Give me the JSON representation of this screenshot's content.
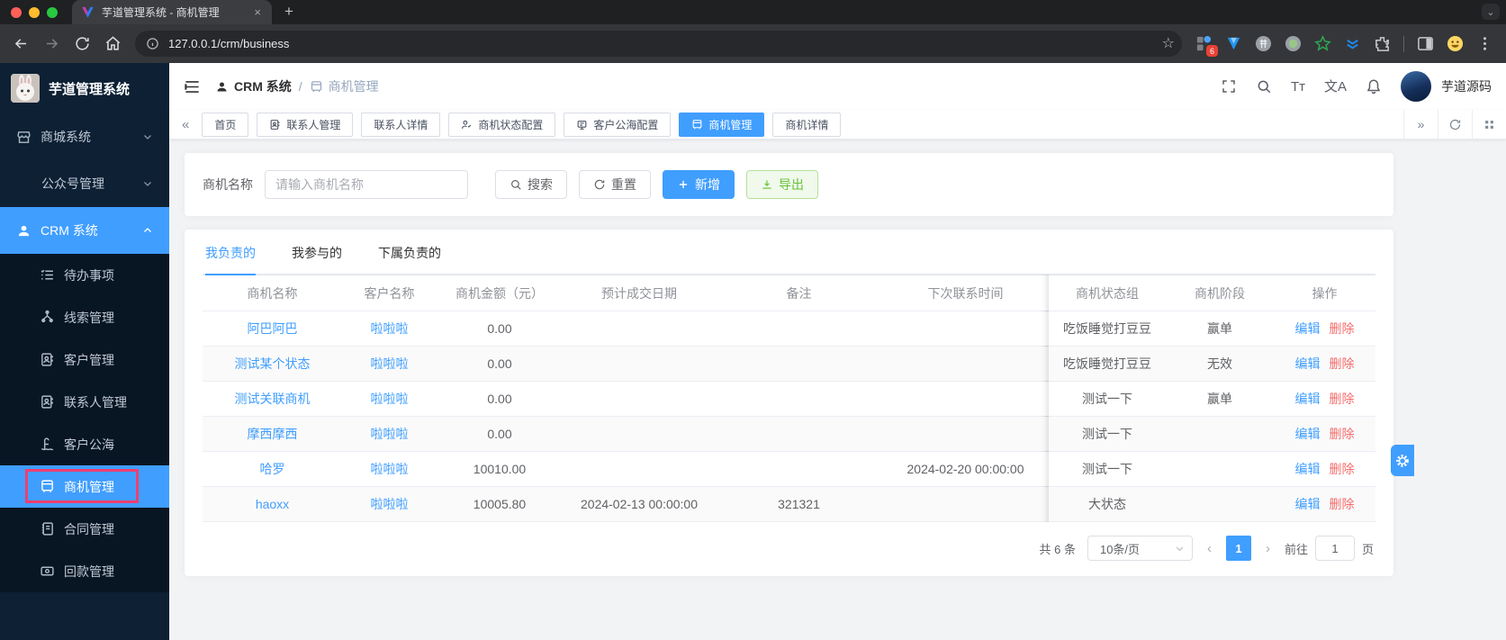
{
  "browser": {
    "tab_title": "芋道管理系统 - 商机管理",
    "url": "127.0.0.1/crm/business",
    "extension_badge": "6"
  },
  "icons_text": {
    "tab_close": "×",
    "new_tab": "+",
    "tab_search_chevron": "⌄",
    "bookmark_star": "☆",
    "font_size": "Tт",
    "language": "文A",
    "tags_collapse_left": "«",
    "tags_collapse_right": "»",
    "pager_prev": "‹",
    "pager_next": "›",
    "plus": "＋"
  },
  "sidebar": {
    "logo_title": "芋道管理系统",
    "top_menu": [
      {
        "label": "商城系统"
      },
      {
        "label": "公众号管理"
      },
      {
        "label": "CRM 系统"
      }
    ],
    "sub_menu": [
      {
        "label": "待办事项"
      },
      {
        "label": "线索管理"
      },
      {
        "label": "客户管理"
      },
      {
        "label": "联系人管理"
      },
      {
        "label": "客户公海"
      },
      {
        "label": "商机管理"
      },
      {
        "label": "合同管理"
      },
      {
        "label": "回款管理"
      }
    ]
  },
  "header": {
    "breadcrumb_1": "CRM 系统",
    "separator": "/",
    "breadcrumb_2": "商机管理",
    "username": "芋道源码"
  },
  "tags": {
    "items": [
      {
        "label": "首页"
      },
      {
        "label": "联系人管理"
      },
      {
        "label": "联系人详情"
      },
      {
        "label": "商机状态配置"
      },
      {
        "label": "客户公海配置"
      },
      {
        "label": "商机管理"
      },
      {
        "label": "商机详情"
      }
    ]
  },
  "search": {
    "label": "商机名称",
    "placeholder": "请输入商机名称",
    "search_btn": "搜索",
    "reset_btn": "重置",
    "add_btn": "新增",
    "export_btn": "导出"
  },
  "tabs": {
    "mine": "我负责的",
    "joined": "我参与的",
    "subordinate": "下属负责的"
  },
  "table": {
    "headers": [
      "商机名称",
      "客户名称",
      "商机金额（元）",
      "预计成交日期",
      "备注",
      "下次联系时间",
      "商机状态组",
      "商机阶段",
      "操作"
    ],
    "edit_label": "编辑",
    "delete_label": "删除",
    "rows": [
      {
        "name": "阿巴阿巴",
        "customer": "啦啦啦",
        "amount": "0.00",
        "expected": "",
        "remark": "",
        "next_time": "",
        "status_group": "吃饭睡觉打豆豆",
        "stage": "赢单"
      },
      {
        "name": "测试某个状态",
        "customer": "啦啦啦",
        "amount": "0.00",
        "expected": "",
        "remark": "",
        "next_time": "",
        "status_group": "吃饭睡觉打豆豆",
        "stage": "无效"
      },
      {
        "name": "测试关联商机",
        "customer": "啦啦啦",
        "amount": "0.00",
        "expected": "",
        "remark": "",
        "next_time": "",
        "status_group": "测试一下",
        "stage": "赢单"
      },
      {
        "name": "摩西摩西",
        "customer": "啦啦啦",
        "amount": "0.00",
        "expected": "",
        "remark": "",
        "next_time": "",
        "status_group": "测试一下",
        "stage": ""
      },
      {
        "name": "哈罗",
        "customer": "啦啦啦",
        "amount": "10010.00",
        "expected": "",
        "remark": "",
        "next_time": "2024-02-20 00:00:00",
        "status_group": "测试一下",
        "stage": ""
      },
      {
        "name": "haoxx",
        "customer": "啦啦啦",
        "amount": "10005.80",
        "expected": "2024-02-13 00:00:00",
        "remark": "321321",
        "next_time": "",
        "status_group": "大状态",
        "stage": ""
      }
    ]
  },
  "pagination": {
    "total": "共 6 条",
    "page_size": "10条/页",
    "current_page": "1",
    "goto_label": "前往",
    "goto_value": "1",
    "unit": "页"
  },
  "colors": {
    "accent": "#409eff",
    "danger": "#f56c6c",
    "success": "#67c23a",
    "sidebar_bg": "#0d2034",
    "submenu_bg": "#081624",
    "annotation_highlight": "#ee3f71"
  }
}
